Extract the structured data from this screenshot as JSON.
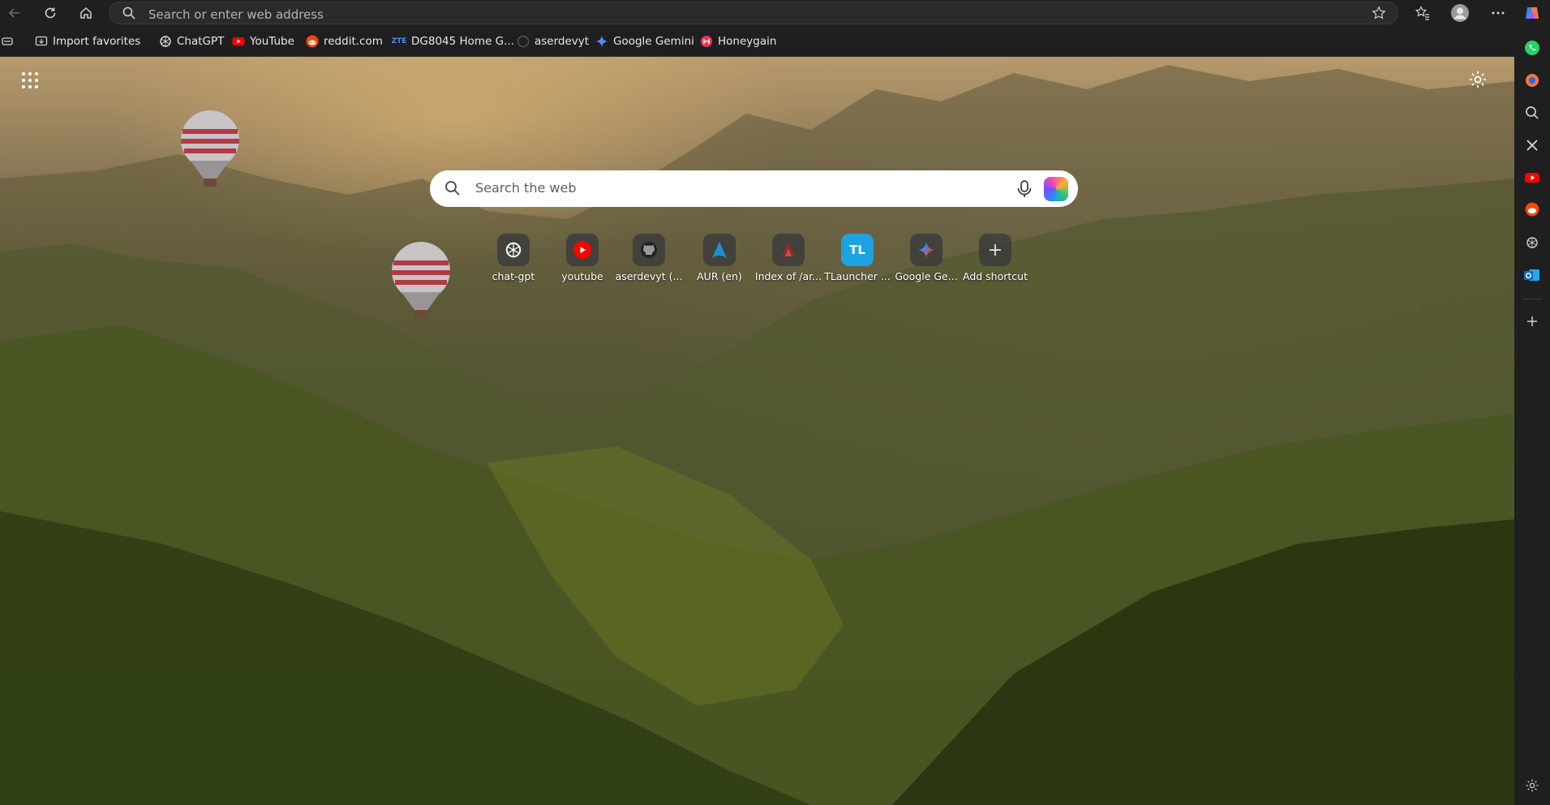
{
  "address_bar": {
    "placeholder": "Search or enter web address"
  },
  "favorites": [
    {
      "label": "Import favorites",
      "icon": "import-icon"
    },
    {
      "label": "ChatGPT",
      "icon": "chatgpt-icon"
    },
    {
      "label": "YouTube",
      "icon": "youtube-icon"
    },
    {
      "label": "reddit.com",
      "icon": "reddit-icon"
    },
    {
      "label": "DG8045 Home G...",
      "icon": "zte-icon",
      "icon_text": "ZTE"
    },
    {
      "label": "aserdevyt",
      "icon": "github-icon"
    },
    {
      "label": "Google Gemini",
      "icon": "gemini-icon"
    },
    {
      "label": "Honeygain",
      "icon": "honeygain-icon"
    }
  ],
  "search": {
    "placeholder": "Search the web"
  },
  "shortcuts": [
    {
      "label": "chat-gpt",
      "icon": "chatgpt-icon"
    },
    {
      "label": "youtube",
      "icon": "youtube-icon"
    },
    {
      "label": "aserdevyt (...",
      "icon": "github-icon"
    },
    {
      "label": "AUR (en)",
      "icon": "arch-icon"
    },
    {
      "label": "Index of /ar...",
      "icon": "index-icon"
    },
    {
      "label": "TLauncher ...",
      "icon": "tlauncher-icon",
      "icon_text": "TL"
    },
    {
      "label": "Google Ge...",
      "icon": "gemini-icon"
    },
    {
      "label": "Add shortcut",
      "icon": "plus-icon",
      "icon_text": "+"
    }
  ],
  "colors": {
    "chrome_bg": "#1f1f1f",
    "youtube_red": "#ff0000",
    "reddit_orange": "#ff4500",
    "whatsapp_green": "#25d366",
    "outlook_blue": "#0f6cbd"
  }
}
